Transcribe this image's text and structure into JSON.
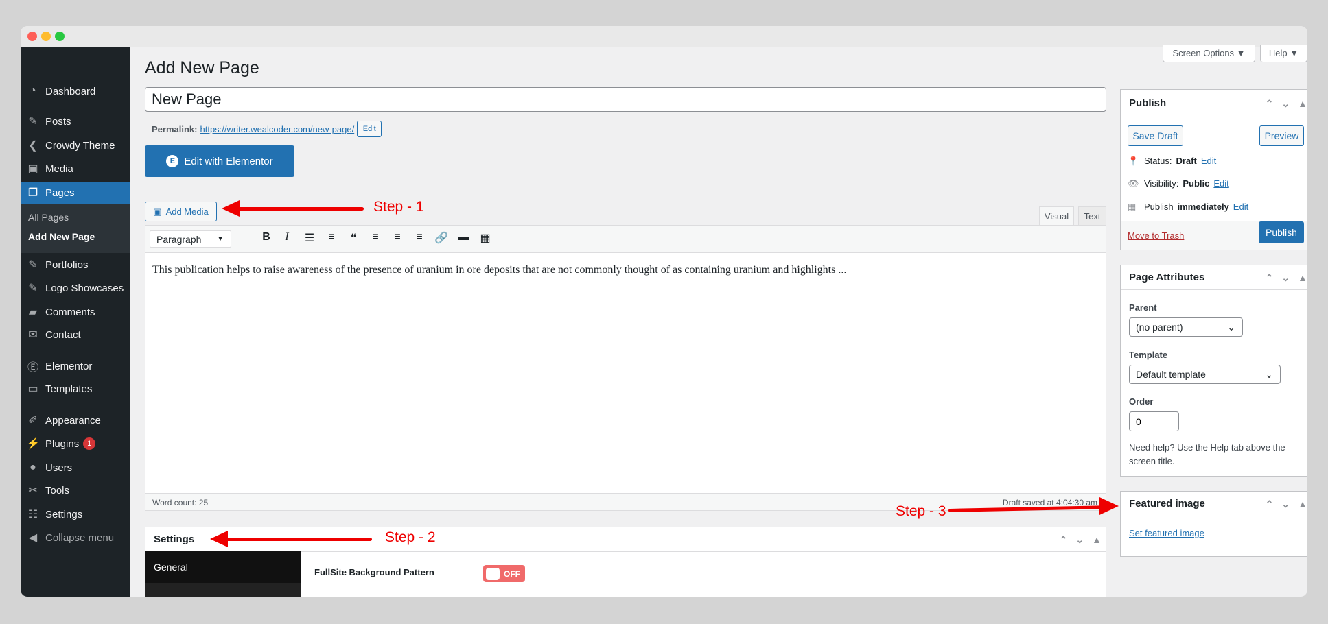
{
  "window": {
    "dots": [
      "#fe5f57",
      "#febc2e",
      "#28c840"
    ]
  },
  "sidebar": {
    "items": [
      {
        "label": "Dashboard",
        "icon": "dashboard-icon",
        "glyph": "◔"
      },
      {
        "label": "Posts",
        "icon": "pin-icon",
        "glyph": "✎"
      },
      {
        "label": "Crowdy Theme",
        "icon": "crowdy-icon",
        "glyph": "❮"
      },
      {
        "label": "Media",
        "icon": "media-icon",
        "glyph": "▣"
      },
      {
        "label": "Pages",
        "icon": "pages-icon",
        "glyph": "❐"
      },
      {
        "label": "Portfolios",
        "icon": "pin-icon",
        "glyph": "✎"
      },
      {
        "label": "Logo Showcases",
        "icon": "pin-icon",
        "glyph": "✎"
      },
      {
        "label": "Comments",
        "icon": "comments-icon",
        "glyph": "▰"
      },
      {
        "label": "Contact",
        "icon": "mail-icon",
        "glyph": "✉"
      },
      {
        "label": "Elementor",
        "icon": "elementor-icon",
        "glyph": "Ⓔ"
      },
      {
        "label": "Templates",
        "icon": "folder-icon",
        "glyph": "▭"
      },
      {
        "label": "Appearance",
        "icon": "brush-icon",
        "glyph": "✐"
      },
      {
        "label": "Plugins",
        "icon": "plugin-icon",
        "glyph": "⚡",
        "badge": "1"
      },
      {
        "label": "Users",
        "icon": "user-icon",
        "glyph": "●"
      },
      {
        "label": "Tools",
        "icon": "wrench-icon",
        "glyph": "✂"
      },
      {
        "label": "Settings",
        "icon": "settings-icon",
        "glyph": "☷"
      },
      {
        "label": "Collapse menu",
        "icon": "collapse-icon",
        "glyph": "◀"
      }
    ],
    "submenu": [
      "All Pages",
      "Add New Page"
    ]
  },
  "header": {
    "title": "Add New Page",
    "screen_options": "Screen Options ▼",
    "help": "Help ▼"
  },
  "editor": {
    "title_value": "New Page",
    "permalink_label": "Permalink:",
    "permalink_url": "https://writer.wealcoder.com/new-page/",
    "permalink_edit": "Edit",
    "elementor_button": "Edit with Elementor",
    "add_media": "Add Media",
    "tab_visual": "Visual",
    "tab_text": "Text",
    "format_select": "Paragraph",
    "toolbar": [
      {
        "icon": "bold-icon",
        "glyph": "B"
      },
      {
        "icon": "italic-icon",
        "glyph": "I"
      },
      {
        "icon": "bullet-list-icon",
        "glyph": "☰"
      },
      {
        "icon": "numbered-list-icon",
        "glyph": "≡"
      },
      {
        "icon": "blockquote-icon",
        "glyph": "❝"
      },
      {
        "icon": "align-left-icon",
        "glyph": "≡"
      },
      {
        "icon": "align-center-icon",
        "glyph": "≡"
      },
      {
        "icon": "align-right-icon",
        "glyph": "≡"
      },
      {
        "icon": "link-icon",
        "glyph": "🔗"
      },
      {
        "icon": "read-more-icon",
        "glyph": "▬"
      },
      {
        "icon": "keyboard-icon",
        "glyph": "▦"
      }
    ],
    "content": "This publication helps to raise awareness of the presence of uranium in ore deposits that are not commonly thought of as containing uranium and highlights ...",
    "word_count": "Word count: 25",
    "draft_saved": "Draft saved at 4:04:30 am"
  },
  "settings_box": {
    "title": "Settings",
    "tab_general": "General",
    "field_label": "FullSite Background Pattern",
    "toggle": "OFF",
    "toggle_on": false,
    "toggle_color": "#f06a6a"
  },
  "annotations": {
    "step1": "Step - 1",
    "step2": "Step - 2",
    "step3": "Step - 3",
    "color": "#e00000"
  },
  "publish": {
    "title": "Publish",
    "save_draft": "Save Draft",
    "preview": "Preview",
    "status_label": "Status:",
    "status_value": "Draft",
    "visibility_label": "Visibility:",
    "visibility_value": "Public",
    "publish_label": "Publish",
    "publish_value": "immediately",
    "edit": "Edit",
    "trash": "Move to Trash",
    "publish_button": "Publish"
  },
  "page_attributes": {
    "title": "Page Attributes",
    "parent_label": "Parent",
    "parent_value": "(no parent)",
    "template_label": "Template",
    "template_value": "Default template",
    "order_label": "Order",
    "order_value": "0",
    "help": "Need help? Use the Help tab above the screen title."
  },
  "featured": {
    "title": "Featured image",
    "link": "Set featured image"
  }
}
